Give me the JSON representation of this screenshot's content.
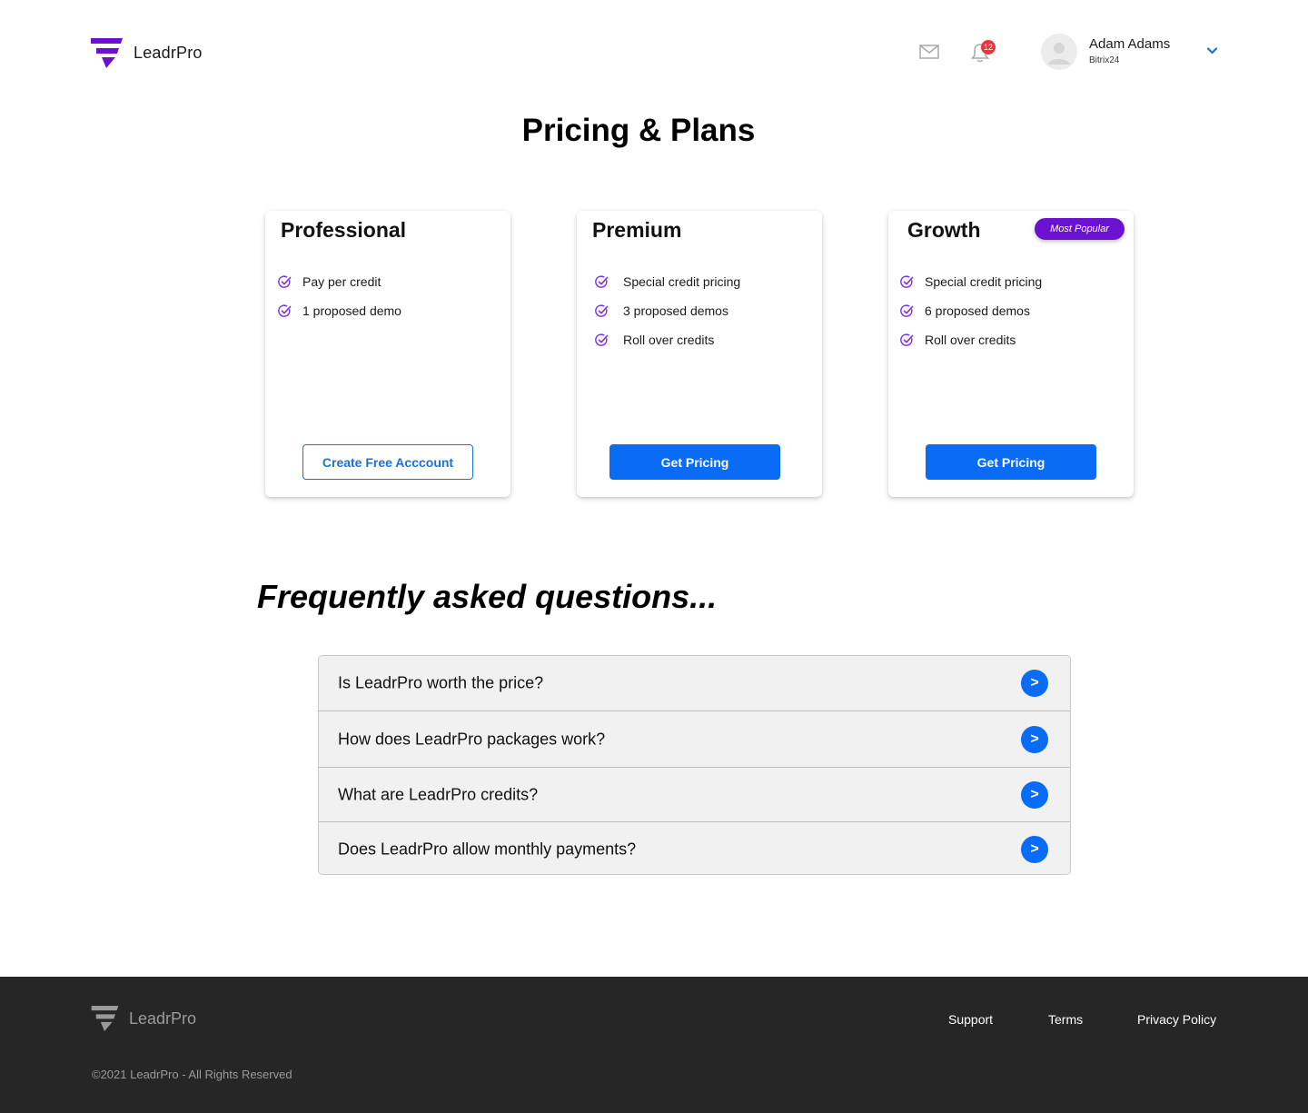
{
  "brand": {
    "name": "LeadrPro",
    "logo_color": "#6b12d1",
    "logo_icon": "leadrpro-logo-icon"
  },
  "header": {
    "mail_icon": "mail-icon",
    "bell_icon": "bell-icon",
    "notification_count": "12",
    "user": {
      "name": "Adam Adams",
      "organization": "Bitrix24"
    }
  },
  "page": {
    "title": "Pricing & Plans"
  },
  "plans": [
    {
      "name": "Professional",
      "features": [
        "Pay per credit",
        "1 proposed demo"
      ],
      "button_label": "Create Free Acccount",
      "button_style": "outline"
    },
    {
      "name": "Premium",
      "features": [
        "Special credit pricing",
        "3 proposed demos",
        "Roll over credits"
      ],
      "button_label": "Get Pricing",
      "button_style": "solid"
    },
    {
      "name": "Growth",
      "badge": "Most Popular",
      "features": [
        "Special credit pricing",
        "6 proposed demos",
        "Roll over credits"
      ],
      "button_label": "Get Pricing",
      "button_style": "solid"
    }
  ],
  "faq": {
    "title": "Frequently asked questions...",
    "items": [
      {
        "question": "Is LeadrPro worth the price?",
        "arrow": ">"
      },
      {
        "question": "How does LeadrPro packages work?",
        "arrow": ">"
      },
      {
        "question": "What are LeadrPro credits?",
        "arrow": ">"
      },
      {
        "question": "Does LeadrPro allow monthly payments?",
        "arrow": ">"
      }
    ]
  },
  "footer": {
    "brand": "LeadrPro",
    "links": {
      "support": "Support",
      "terms": "Terms",
      "privacy": "Privacy Policy"
    },
    "copyright": "©2021 LeadrPro - All Rights Reserved"
  },
  "colors": {
    "accent": "#0a6cf5",
    "brand_purple": "#6b12d1",
    "badge_red": "#e8363e",
    "footer_bg": "#262626",
    "faq_bg": "#f1f1f1"
  }
}
